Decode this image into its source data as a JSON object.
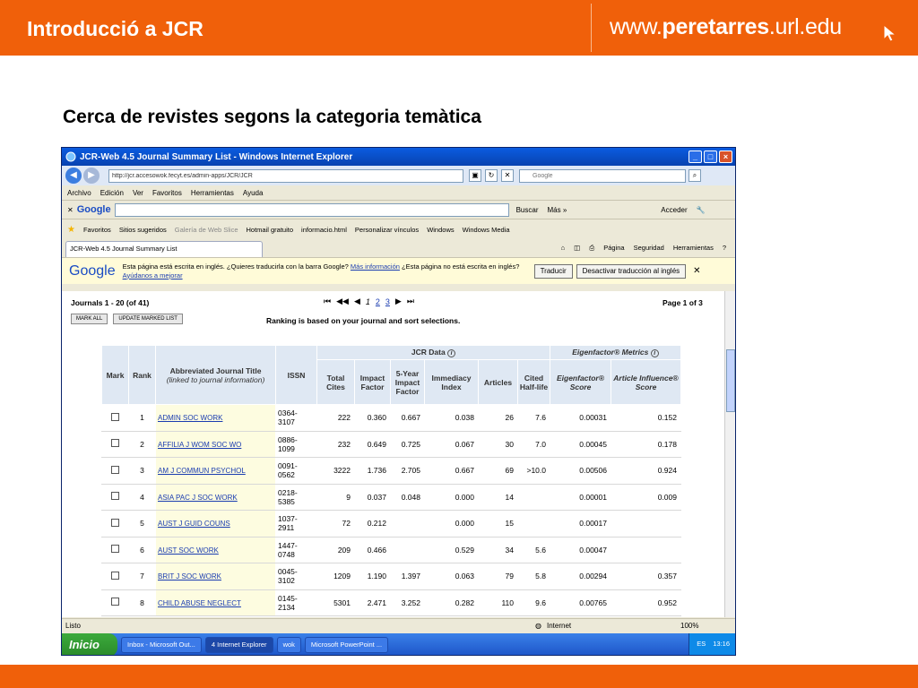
{
  "slide": {
    "title": "Introducció a JCR",
    "url_prefix": "www.",
    "url_bold": "peretarres",
    "url_suffix": ".url.edu",
    "heading": "Cerca de revistes segons la categoria temàtica",
    "accent_color": "#f0600a"
  },
  "browser": {
    "window_title": "JCR-Web 4.5 Journal Summary List - Windows Internet Explorer",
    "address": "http://jcr.accesowok.fecyt.es/admin-apps/JCR/JCR",
    "search_placeholder": "Google",
    "menu": [
      "Archivo",
      "Edición",
      "Ver",
      "Favoritos",
      "Herramientas",
      "Ayuda"
    ],
    "google_bar": {
      "logo": "Google",
      "buscar": "Buscar",
      "mas": "Más »",
      "acceder": "Acceder"
    },
    "favorites": [
      "Favoritos",
      "Sitios sugeridos",
      "Galería de Web Slice",
      "Hotmail gratuito",
      "informacio.html",
      "Personalizar vínculos",
      "Windows",
      "Windows Media"
    ],
    "tab_title": "JCR-Web 4.5 Journal Summary List",
    "tab_tools": [
      "Página",
      "Seguridad",
      "Herramientas"
    ],
    "translate": {
      "logo": "Google",
      "message": "Esta página está escrita en inglés. ¿Quieres traducirla con la barra Google?",
      "more_info": "Más información",
      "message2": "¿Esta página no está escrita en inglés?",
      "help_link": "Ayúdanos a mejorar",
      "translate_btn": "Traducir",
      "disable_btn": "Desactivar traducción al inglés"
    },
    "status": {
      "text": "Listo",
      "zone": "Internet",
      "zoom": "100%"
    }
  },
  "jcr": {
    "journals_range": "Journals 1 - 20 (of 41)",
    "pages": [
      "1",
      "2",
      "3"
    ],
    "page_of": "Page 1 of 3",
    "mark_all": "MARK ALL",
    "update_marked": "UPDATE MARKED LIST",
    "ranking_note": "Ranking is based on your journal and sort selections.",
    "group_headers": {
      "jcr_data": "JCR Data",
      "eigen_metrics": "Eigenfactor® Metrics"
    },
    "columns": {
      "mark": "Mark",
      "rank": "Rank",
      "title": "Abbreviated Journal Title",
      "title_sub": "(linked to journal information)",
      "issn": "ISSN",
      "total_cites": "Total Cites",
      "impact": "Impact Factor",
      "five_year": "5-Year Impact Factor",
      "immediacy": "Immediacy Index",
      "articles": "Articles",
      "half_life": "Cited Half-life",
      "eigen_score": "Eigenfactor® Score",
      "article_influence": "Article Influence® Score"
    },
    "rows": [
      {
        "rank": "1",
        "title": "ADMIN SOC WORK",
        "issn": "0364-3107",
        "cites": "222",
        "impact": "0.360",
        "five": "0.667",
        "immed": "0.038",
        "articles": "26",
        "half": "7.6",
        "eigen": "0.00031",
        "influence": "0.152"
      },
      {
        "rank": "2",
        "title": "AFFILIA J WOM SOC WO",
        "issn": "0886-1099",
        "cites": "232",
        "impact": "0.649",
        "five": "0.725",
        "immed": "0.067",
        "articles": "30",
        "half": "7.0",
        "eigen": "0.00045",
        "influence": "0.178"
      },
      {
        "rank": "3",
        "title": "AM J COMMUN PSYCHOL",
        "issn": "0091-0562",
        "cites": "3222",
        "impact": "1.736",
        "five": "2.705",
        "immed": "0.667",
        "articles": "69",
        "half": ">10.0",
        "eigen": "0.00506",
        "influence": "0.924"
      },
      {
        "rank": "4",
        "title": "ASIA PAC J SOC WORK",
        "issn": "0218-5385",
        "cites": "9",
        "impact": "0.037",
        "five": "0.048",
        "immed": "0.000",
        "articles": "14",
        "half": "",
        "eigen": "0.00001",
        "influence": "0.009"
      },
      {
        "rank": "5",
        "title": "AUST J GUID COUNS",
        "issn": "1037-2911",
        "cites": "72",
        "impact": "0.212",
        "five": "",
        "immed": "0.000",
        "articles": "15",
        "half": "",
        "eigen": "0.00017",
        "influence": ""
      },
      {
        "rank": "6",
        "title": "AUST SOC WORK",
        "issn": "1447-0748",
        "cites": "209",
        "impact": "0.466",
        "five": "",
        "immed": "0.529",
        "articles": "34",
        "half": "5.6",
        "eigen": "0.00047",
        "influence": ""
      },
      {
        "rank": "7",
        "title": "BRIT J SOC WORK",
        "issn": "0045-3102",
        "cites": "1209",
        "impact": "1.190",
        "five": "1.397",
        "immed": "0.063",
        "articles": "79",
        "half": "5.8",
        "eigen": "0.00294",
        "influence": "0.357"
      },
      {
        "rank": "8",
        "title": "CHILD ABUSE NEGLECT",
        "issn": "0145-2134",
        "cites": "5301",
        "impact": "2.471",
        "five": "3.252",
        "immed": "0.282",
        "articles": "110",
        "half": "9.6",
        "eigen": "0.00765",
        "influence": "0.952"
      }
    ]
  },
  "taskbar": {
    "start": "Inicio",
    "tasks": [
      "Inbox - Microsoft Out...",
      "4 Internet Explorer",
      "wok",
      "Microsoft PowerPoint ..."
    ],
    "lang": "ES",
    "clock": "13:16"
  }
}
